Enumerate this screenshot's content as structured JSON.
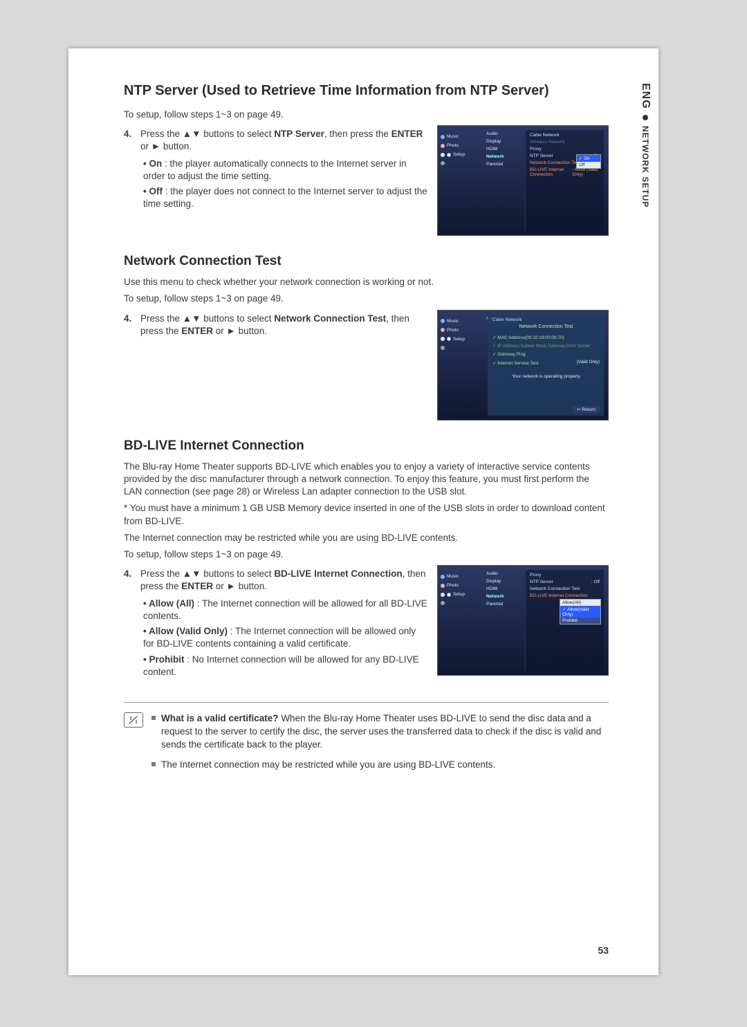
{
  "side": {
    "lang": "ENG",
    "section": "NETWORK SETUP"
  },
  "s1": {
    "title": "NTP Server (Used to Retrieve Time Information from NTP Server)",
    "setup_line": "To setup, follow steps 1~3 on page 49.",
    "step_num": "4.",
    "step_text_a": "Press the ▲▼ buttons to select ",
    "step_bold_a": "NTP Server",
    "step_text_b": ", then press the ",
    "step_bold_b": "ENTER",
    "step_text_c": " or ► button.",
    "on_label": "On",
    "on_text": " : the player automatically connects to the Internet server in order to adjust the time setting.",
    "off_label": "Off",
    "off_text": " : the player does not connect to the Internet server to adjust the time setting."
  },
  "shot1": {
    "nav": {
      "music": "Music",
      "photo": "Photo",
      "setup": "Setup"
    },
    "mid": {
      "audio": "Audio",
      "display": "Display",
      "hdmi": "HDMI",
      "network": "Network",
      "parental": "Parental"
    },
    "right": {
      "cable": "Cable Network",
      "wireless": "Wireless Network",
      "proxy": "Proxy",
      "ntp": "NTP Server",
      "ntp_v": ": On",
      "nct": "Network Connection Test",
      "bd": "BD-LIVE Internet Connection",
      "bd_v": ": Allow (Valid Only)"
    },
    "dropdown": {
      "on": "✓ On",
      "off": "Off"
    }
  },
  "s2": {
    "title": "Network Connection Test",
    "intro": "Use this menu to check whether your network connection is working or not.",
    "setup_line": "To setup, follow steps 1~3 on page 49.",
    "step_num": "4.",
    "step_text_a": "Press the ▲▼ buttons to select ",
    "step_bold_a": "Network Connection Test",
    "step_text_b": ", then press the ",
    "step_bold_b": "ENTER",
    "step_text_c": " or ► button."
  },
  "shot2": {
    "nav": {
      "music": "Music",
      "photo": "Photo",
      "setup": "Setup"
    },
    "mid_audio": "Audio",
    "right_cable": "Cable Network",
    "title": "Network Connection Test",
    "r1": "✓ MAC Address(00:10:18:00:00:70)",
    "r2": "✓ IP Address,Subnet Mask,Gateway,DNS Server",
    "r3": "✓ Gateway Ping",
    "r4": "✓ Internet Service Test",
    "r4_right": "(Valid Only)",
    "status": "Your network is operating properly",
    "return_btn": "↩ Return"
  },
  "s3": {
    "title": "BD-LIVE Internet Connection",
    "p1": "The Blu-ray Home Theater supports BD-LIVE which enables you to enjoy a variety of interactive service contents provided by the disc manufacturer through a network connection. To enjoy this feature, you must first perform the LAN connection (see page 28) or Wireless Lan adapter connection to the USB slot.",
    "p2": "* You must have a minimum 1 GB USB Memory device inserted in one of the USB slots in order to download content from BD-LIVE.",
    "p3": "The Internet connection may be restricted while you are using BD-LIVE contents.",
    "setup_line": "To setup, follow steps 1~3 on page 49.",
    "step_num": "4.",
    "step_text_a": "Press the ▲▼ buttons to select ",
    "step_bold_a": "BD-LIVE Internet Connection",
    "step_text_b": ", then press the ",
    "step_bold_b": "ENTER",
    "step_text_c": " or ► button.",
    "allow_all_label": "Allow (All)",
    "allow_all_text": " : The Internet connection will be allowed for all BD-LIVE contents.",
    "allow_valid_label": "Allow (Valid Only)",
    "allow_valid_text": " : The Internet connection will be allowed only for BD-LIVE contents containing a valid certificate.",
    "prohibit_label": "Prohibit",
    "prohibit_text": " : No Internet connection will be allowed for any BD-LIVE content."
  },
  "shot3": {
    "nav": {
      "music": "Music",
      "photo": "Photo",
      "setup": "Setup"
    },
    "mid": {
      "audio": "Audio",
      "display": "Display",
      "hdmi": "HDMI",
      "network": "Network",
      "parental": "Parental"
    },
    "right": {
      "proxy": "Proxy",
      "ntp": "NTP Server",
      "ntp_v": ": Off",
      "nct": "Network Connection Test",
      "bd": "BD-LIVE Internet Connection"
    },
    "dropdown": {
      "all": "Allow(All)",
      "valid": "✓ Allow(Valid Only)",
      "prohibit": "Prohibit"
    }
  },
  "notes": {
    "n1_bold": "What is a valid certificate?",
    "n1_text": " When the Blu-ray Home Theater uses BD-LIVE to send the disc data and a request to the server to certify the disc, the server uses the transferred data to check if the disc is valid and sends the certificate back to the player.",
    "n2": "The Internet connection may be restricted while you are using BD-LIVE contents."
  },
  "page_num": "53"
}
